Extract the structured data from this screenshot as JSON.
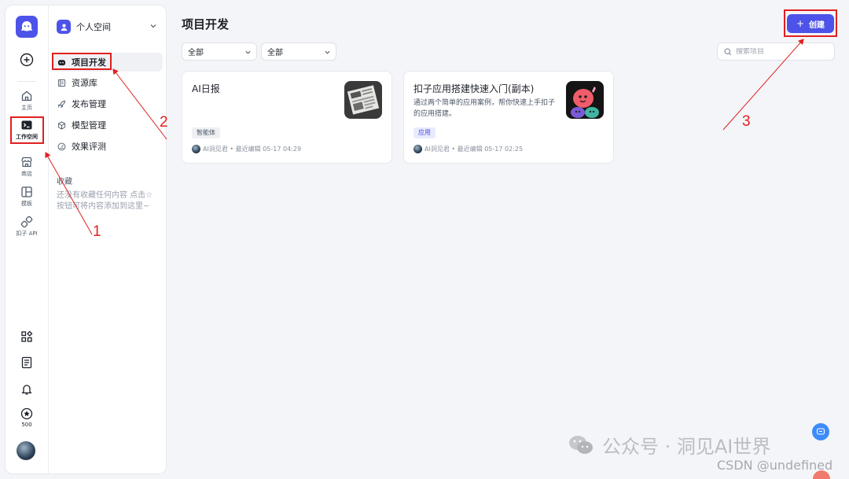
{
  "rail": {
    "items": [
      {
        "label": "主页",
        "icon": "home-icon"
      },
      {
        "label": "工作空间",
        "icon": "terminal-icon"
      },
      {
        "label": "商店",
        "icon": "store-icon"
      },
      {
        "label": "模板",
        "icon": "template-icon"
      },
      {
        "label": "扣子 API",
        "icon": "api-icon"
      }
    ],
    "coins": "500"
  },
  "side": {
    "space": "个人空间",
    "nav": [
      {
        "label": "项目开发",
        "icon": "bot-icon"
      },
      {
        "label": "资源库",
        "icon": "library-icon"
      },
      {
        "label": "发布管理",
        "icon": "rocket-icon"
      },
      {
        "label": "模型管理",
        "icon": "cube-icon"
      },
      {
        "label": "效果评测",
        "icon": "gauge-icon"
      }
    ],
    "favorites_title": "收藏",
    "favorites_empty": "还没有收藏任何内容 点击☆按钮可将内容添加到这里~"
  },
  "main": {
    "title": "项目开发",
    "create_label": "创建",
    "filter1": "全部",
    "filter2": "全部",
    "search_placeholder": "搜索项目",
    "cards": [
      {
        "title": "AI日报",
        "desc": "",
        "tag": "智能体",
        "author": "AI洞见君",
        "meta": "• 最近编辑 05-17 04:29"
      },
      {
        "title": "扣子应用搭建快速入门(副本)",
        "desc": "通过两个简单的应用案例，帮你快速上手扣子的应用搭建。",
        "tag": "应用",
        "author": "AI洞见君",
        "meta": "• 最近编辑 05-17 02:25"
      }
    ]
  },
  "annotations": {
    "n1": "1",
    "n2": "2",
    "n3": "3"
  },
  "watermark": {
    "text": "公众号 · 洞见AI世界",
    "csdn": "CSDN @undefined"
  },
  "colors": {
    "accent": "#4d53e8",
    "annotation": "#e02020"
  }
}
